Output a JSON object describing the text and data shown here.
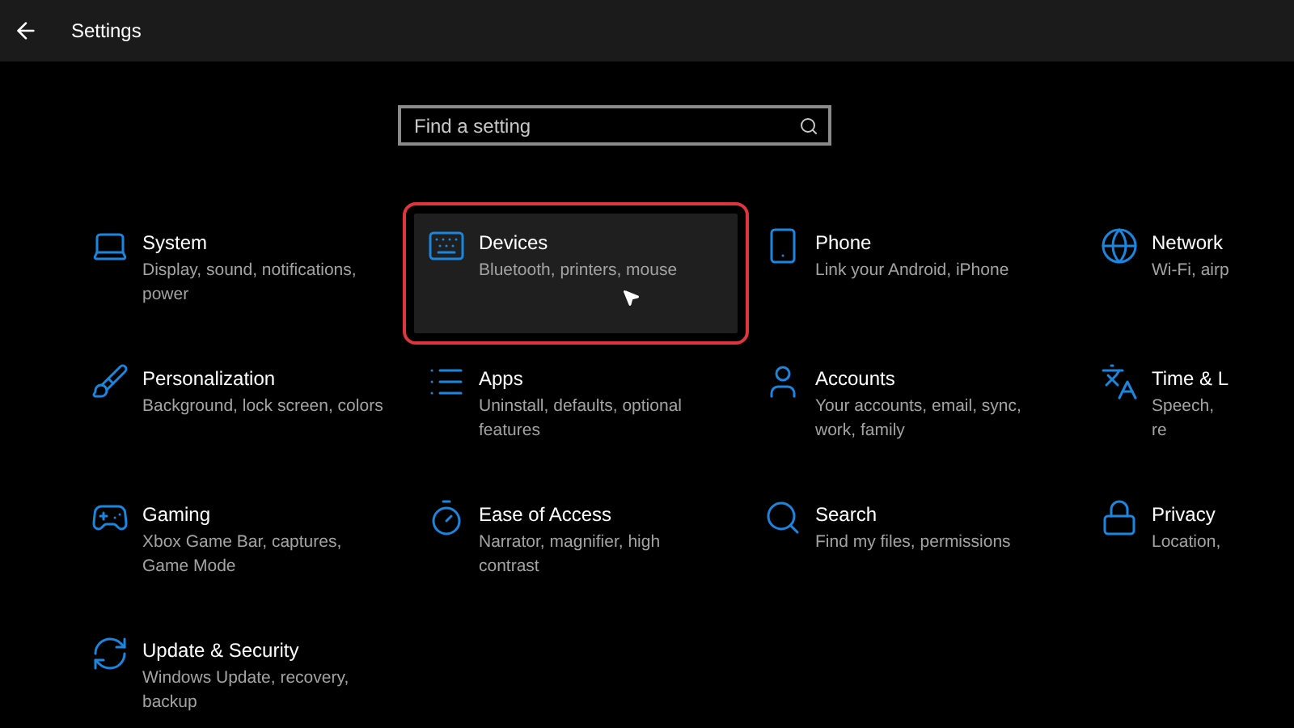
{
  "window": {
    "title": "Settings"
  },
  "search": {
    "placeholder": "Find a setting"
  },
  "tiles": [
    {
      "kind": "system",
      "title": "System",
      "description": "Display, sound, notifications, power",
      "selected": false
    },
    {
      "kind": "devices",
      "title": "Devices",
      "description": "Bluetooth, printers, mouse",
      "selected": true
    },
    {
      "kind": "phone",
      "title": "Phone",
      "description": "Link your Android, iPhone",
      "selected": false
    },
    {
      "kind": "network",
      "title": "Network",
      "description": "Wi-Fi, airp",
      "selected": false
    },
    {
      "kind": "personalization",
      "title": "Personalization",
      "description": "Background, lock screen, colors",
      "selected": false
    },
    {
      "kind": "apps",
      "title": "Apps",
      "description": "Uninstall, defaults, optional features",
      "selected": false
    },
    {
      "kind": "accounts",
      "title": "Accounts",
      "description": "Your accounts, email, sync, work, family",
      "selected": false
    },
    {
      "kind": "time",
      "title": "Time & L",
      "description": "Speech, re",
      "selected": false
    },
    {
      "kind": "gaming",
      "title": "Gaming",
      "description": "Xbox Game Bar, captures, Game Mode",
      "selected": false
    },
    {
      "kind": "ease",
      "title": "Ease of Access",
      "description": "Narrator, magnifier, high contrast",
      "selected": false
    },
    {
      "kind": "search",
      "title": "Search",
      "description": "Find my files, permissions",
      "selected": false
    },
    {
      "kind": "privacy",
      "title": "Privacy",
      "description": "Location,",
      "selected": false
    },
    {
      "kind": "update",
      "title": "Update & Security",
      "description": "Windows Update, recovery, backup",
      "selected": false
    }
  ]
}
